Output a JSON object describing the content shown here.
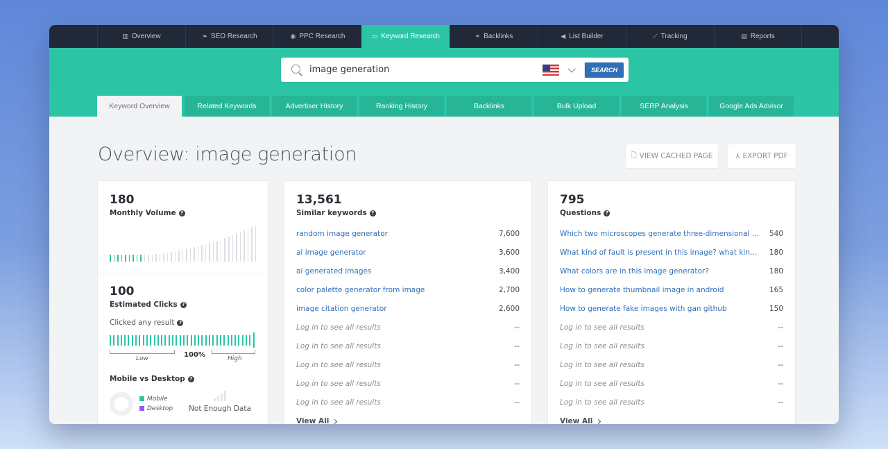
{
  "nav": {
    "items": [
      {
        "label": "Overview",
        "icon": "bar-chart-icon",
        "glyph": "▥",
        "active": false
      },
      {
        "label": "SEO Research",
        "icon": "leaf-icon",
        "glyph": "❧",
        "active": false
      },
      {
        "label": "PPC Research",
        "icon": "target-icon",
        "glyph": "◉",
        "active": false
      },
      {
        "label": "Keyword Research",
        "icon": "keyboard-icon",
        "glyph": "▭",
        "active": true
      },
      {
        "label": "Backlinks",
        "icon": "link-icon",
        "glyph": "⚭",
        "active": false
      },
      {
        "label": "List Builder",
        "icon": "megaphone-icon",
        "glyph": "◀",
        "active": false
      },
      {
        "label": "Tracking",
        "icon": "line-chart-icon",
        "glyph": "⟋",
        "active": false
      },
      {
        "label": "Reports",
        "icon": "document-icon",
        "glyph": "▤",
        "active": false
      }
    ]
  },
  "search": {
    "value": "image generation",
    "country": "United States",
    "button_label": "SEARCH"
  },
  "subtabs": [
    {
      "label": "Keyword Overview",
      "active": true
    },
    {
      "label": "Related Keywords",
      "active": false
    },
    {
      "label": "Advertiser History",
      "active": false
    },
    {
      "label": "Ranking History",
      "active": false
    },
    {
      "label": "Backlinks",
      "active": false
    },
    {
      "label": "Bulk Upload",
      "active": false
    },
    {
      "label": "SERP Analysis",
      "active": false
    },
    {
      "label": "Google Ads Advisor",
      "active": false
    }
  ],
  "page": {
    "title": "Overview: image generation",
    "view_cached_label": "VIEW CACHED PAGE",
    "export_pdf_label": "EXPORT PDF"
  },
  "metrics": {
    "monthly_volume": {
      "value": "180",
      "label": "Monthly Volume",
      "highlighted_bars": 9,
      "total_bars": 39
    },
    "estimated_clicks": {
      "value": "100",
      "label": "Estimated Clicks"
    },
    "clicked_any_result": {
      "label": "Clicked any result",
      "percent": "100%",
      "low_label": "Low",
      "high_label": "High",
      "fraction": 1.0
    },
    "mobile_vs_desktop": {
      "label": "Mobile vs Desktop",
      "legend": [
        {
          "label": "Mobile",
          "color": "#2bc5a6"
        },
        {
          "label": "Desktop",
          "color": "#8b5cf6"
        }
      ],
      "status": "Not Enough Data"
    }
  },
  "similar_keywords": {
    "count": "13,561",
    "label": "Similar keywords",
    "rows": [
      {
        "keyword": "random image generator",
        "volume": "7,600"
      },
      {
        "keyword": "ai image generator",
        "volume": "3,600"
      },
      {
        "keyword": "ai generated images",
        "volume": "3,400"
      },
      {
        "keyword": "color palette generator from image",
        "volume": "2,700"
      },
      {
        "keyword": "image citation generator",
        "volume": "2,600"
      }
    ],
    "locked_rows": [
      {
        "text": "Log in to see all results",
        "value": "--"
      },
      {
        "text": "Log in to see all results",
        "value": "--"
      },
      {
        "text": "Log in to see all results",
        "value": "--"
      },
      {
        "text": "Log in to see all results",
        "value": "--"
      },
      {
        "text": "Log in to see all results",
        "value": "--"
      }
    ],
    "view_all_label": "View All"
  },
  "questions": {
    "count": "795",
    "label": "Questions",
    "rows": [
      {
        "keyword": "Which two microscopes generate three-dimensional images?",
        "volume": "540"
      },
      {
        "keyword": "What kind of fault is present in this image? what kind of str...",
        "volume": "180"
      },
      {
        "keyword": "What colors are in this image generator?",
        "volume": "180"
      },
      {
        "keyword": "How to generate thumbnail image in android",
        "volume": "165"
      },
      {
        "keyword": "How to generate fake images with gan github",
        "volume": "150"
      }
    ],
    "locked_rows": [
      {
        "text": "Log in to see all results",
        "value": "--"
      },
      {
        "text": "Log in to see all results",
        "value": "--"
      },
      {
        "text": "Log in to see all results",
        "value": "--"
      },
      {
        "text": "Log in to see all results",
        "value": "--"
      },
      {
        "text": "Log in to see all results",
        "value": "--"
      }
    ],
    "view_all_label": "View All"
  },
  "colors": {
    "accent": "#2bc5a6",
    "nav_bg": "#212838",
    "link": "#2f6fb8",
    "search_button": "#2f6fb8"
  }
}
